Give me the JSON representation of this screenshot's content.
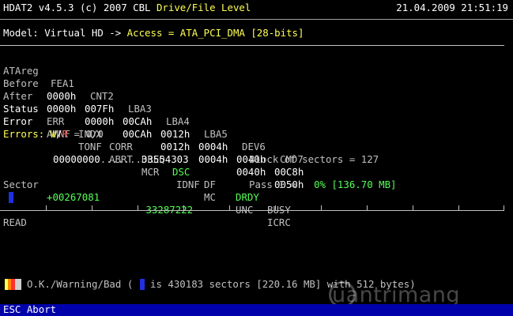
{
  "header": {
    "program": "HDAT2 v4.5.3 (c) 2007 CBL",
    "mode": "Drive/File Level",
    "datetime": "21.04.2009 21:51:19"
  },
  "model": {
    "label": "Model: Virtual HD ->",
    "access": "Access = ATA_PCI_DMA [28-bits]"
  },
  "ata_table": {
    "header": [
      "ATAreg",
      "FEA1",
      "CNT2",
      "LBA3",
      "LBA4",
      "LBA5",
      "DEV6",
      "CMD7"
    ],
    "before": [
      "Before",
      "0000h",
      "007Fh",
      "00CAh",
      "0012h",
      "0004h",
      "0040h",
      "00C8h"
    ],
    "after": [
      "After",
      "0000h",
      "0000h",
      "00CAh",
      "0012h",
      "0004h",
      "0040h",
      "0050h"
    ],
    "status": [
      "Status",
      "ERR",
      "INDX",
      "CORR",
      "DREQ",
      "DSC",
      "DF",
      "DRDY",
      "BUSY"
    ],
    "error": [
      "Error",
      "AMNF",
      "TONF",
      "ABRT",
      "MCR",
      "IDNF",
      "MC",
      "UNC",
      "ICRC"
    ]
  },
  "errors": {
    "label": "Errors:",
    "w": "W",
    "slash": "/",
    "r": "R",
    "value": "= 0/0"
  },
  "sector": {
    "range_start": "00000000",
    "range_dots": ".......",
    "range_end": "33554303",
    "label": "Sector",
    "current": "+00267081",
    "remaining": "-33287222"
  },
  "block": {
    "text": "Block of sectors = 127",
    "pass_label": "Pass 1 =",
    "pass_value": "0% [136.70 MB]"
  },
  "operation": "READ",
  "legend": {
    "text_prefix": "O.K./Warning/Bad (",
    "text_suffix": "is 430183 sectors [220.16 MB] with 512 bytes)"
  },
  "footer": {
    "hint": "ESC Abort"
  },
  "watermark": {
    "text": "uantrimang"
  },
  "colors": {
    "background": "#000000",
    "text": "#c0c0c0",
    "highlight": "#ffff55",
    "green": "#55ff55",
    "red": "#ff5555",
    "cursor_blue": "#2030e0",
    "status_bar": "#0000aa"
  }
}
